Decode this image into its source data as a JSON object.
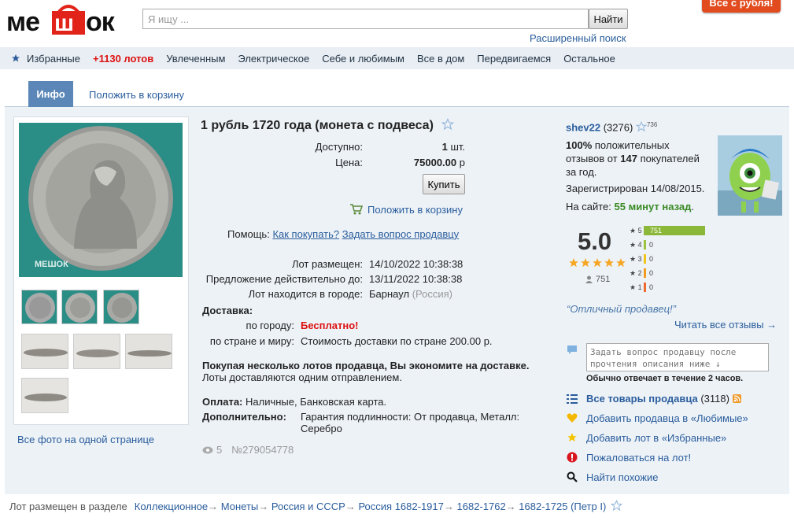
{
  "header": {
    "logo_text": "МЕШОК",
    "search_placeholder": "Я ищу ...",
    "search_button": "Найти",
    "advanced_search": "Расширенный поиск",
    "promo": "Все с рубля!"
  },
  "nav": {
    "items": [
      "Избранные",
      "+1130 лотов",
      "Увлеченным",
      "Электрическое",
      "Себе и любимым",
      "Все в дом",
      "Передвигаемся",
      "Остальное"
    ]
  },
  "tabs": {
    "info": "Инфо",
    "cart": "Положить в корзину"
  },
  "photos": {
    "all_photos": "Все фото на одной странице",
    "watermark": "МЕШОК"
  },
  "lot": {
    "title": "1 рубль 1720 года (монета с подвеса)",
    "available_label": "Доступно:",
    "available_value": "1",
    "available_unit": "шт.",
    "price_label": "Цена:",
    "price_value": "75000.00",
    "price_unit": "р",
    "buy_button": "Купить",
    "add_to_cart": "Положить в корзину",
    "help_label": "Помощь:",
    "how_to_buy": "Как покупать?",
    "ask_seller": "Задать вопрос продавцу",
    "posted_label": "Лот размещен:",
    "posted_value": "14/10/2022 10:38:38",
    "valid_label": "Предложение действительно до:",
    "valid_value": "13/11/2022 10:38:38",
    "city_label": "Лот находится в городе:",
    "city_value": "Барнаул",
    "country_value": "(Россия)",
    "delivery_header": "Доставка:",
    "city_delivery_label": "по городу:",
    "city_delivery_value": "Бесплатно!",
    "country_delivery_label": "по стране и миру:",
    "country_delivery_value": "Стоимость доставки по стране 200.00 р.",
    "multi_lot_bold": "Покупая несколько лотов продавца, Вы экономите на доставке.",
    "multi_lot_note": "Лоты доставляются одним отправлением.",
    "payment_label": "Оплата:",
    "payment_value": "Наличные, Банковская карта.",
    "extra_label": "Дополнительно:",
    "extra_value_1": "Гарантия подлинности: От продавца, Металл:",
    "extra_value_2": "Серебро",
    "views": "5",
    "lot_number": "№279054778"
  },
  "seller": {
    "name": "shev22",
    "feedback_count": "(3276)",
    "star_count": "736",
    "positive_pct": "100%",
    "positive_line_1": "положительных",
    "positive_line_2a": "отзывов от",
    "positive_buyers": "147",
    "positive_line_2b": "покупателей",
    "positive_line_3": "за год.",
    "registered": "Зарегистрирован 14/08/2015.",
    "online_label": "На сайте:",
    "online_value": "55 минут назад",
    "rating": "5.0",
    "rating_votes": "751",
    "bars": [
      {
        "star": "5",
        "count": "751",
        "fill": 1.0,
        "color": "#8cb83a"
      },
      {
        "star": "4",
        "count": "0",
        "fill": 0,
        "color": "#9cc23e"
      },
      {
        "star": "3",
        "count": "0",
        "fill": 0,
        "color": "#f0c419"
      },
      {
        "star": "2",
        "count": "0",
        "fill": 0,
        "color": "#f29c1f"
      },
      {
        "star": "1",
        "count": "0",
        "fill": 0,
        "color": "#ee6a2d"
      }
    ],
    "quote": "“Отличный продавец!”",
    "read_reviews": "Читать все отзывы →",
    "question_placeholder": "Задать вопрос продавцу после прочтения описания ниже ↓",
    "reply_note": "Обычно отвечает в течение 2 часов.",
    "all_items": "Все товары продавца",
    "all_items_count": "(3118)",
    "add_favorite_seller": "Добавить продавца в «Любимые»",
    "add_favorite_lot": "Добавить лот в «Избранные»",
    "complain": "Пожаловаться на лот!",
    "find_similar": "Найти похожие"
  },
  "breadcrumb": {
    "prefix": "Лот размещен в разделе",
    "items": [
      "Коллекционное",
      "Монеты",
      "Россия и СССР",
      "Россия 1682-1917",
      "1682-1762",
      "1682-1725 (Петр I)"
    ]
  }
}
